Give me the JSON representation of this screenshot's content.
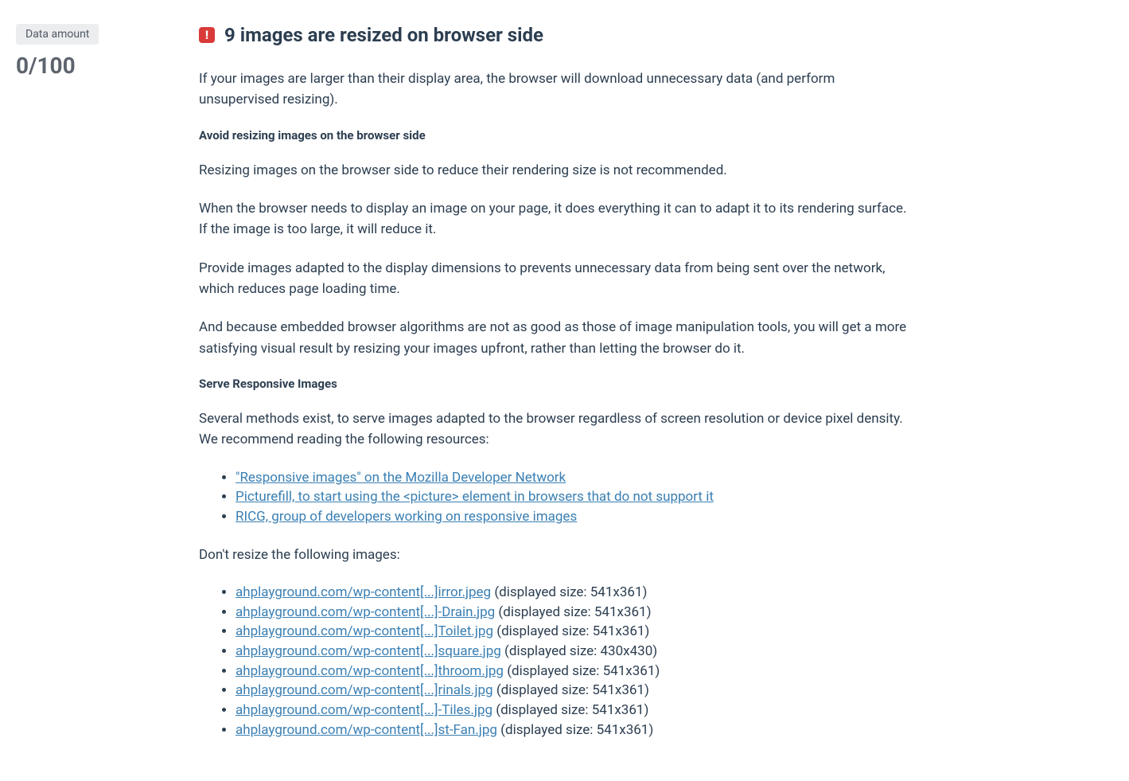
{
  "sidebar": {
    "badge_label": "Data amount",
    "score": "0/100"
  },
  "title": "9 images are resized on browser side",
  "intro": "If your images are larger than their display area, the browser will download unnecessary data (and perform unsupervised resizing).",
  "section1": {
    "heading": "Avoid resizing images on the browser side",
    "p1": "Resizing images on the browser side to reduce their rendering size is not recommended.",
    "p2": "When the browser needs to display an image on your page, it does everything it can to adapt it to its rendering surface. If the image is too large, it will reduce it.",
    "p3": "Provide images adapted to the display dimensions to prevents unnecessary data from being sent over the network, which reduces page loading time.",
    "p4": "And because embedded browser algorithms are not as good as those of image manipulation tools, you will get a more satisfying visual result by resizing your images upfront, rather than letting the browser do it."
  },
  "section2": {
    "heading": "Serve Responsive Images",
    "intro": "Several methods exist, to serve images adapted to the browser regardless of screen resolution or device pixel density. We recommend reading the following resources:",
    "resources": [
      "\"Responsive images\" on the Mozilla Developer Network",
      "Picturefill, to start using the <picture> element in browsers that do not support it",
      "RICG, group of developers working on responsive images"
    ]
  },
  "images_section": {
    "intro": "Don't resize the following images:",
    "items": [
      {
        "url": "ahplayground.com/wp-content[...]irror.jpeg",
        "size": " (displayed size: 541x361)"
      },
      {
        "url": "ahplayground.com/wp-content[...]-Drain.jpg",
        "size": " (displayed size: 541x361)"
      },
      {
        "url": "ahplayground.com/wp-content[...]Toilet.jpg",
        "size": " (displayed size: 541x361)"
      },
      {
        "url": "ahplayground.com/wp-content[...]square.jpg",
        "size": " (displayed size: 430x430)"
      },
      {
        "url": "ahplayground.com/wp-content[...]throom.jpg",
        "size": " (displayed size: 541x361)"
      },
      {
        "url": "ahplayground.com/wp-content[...]rinals.jpg",
        "size": " (displayed size: 541x361)"
      },
      {
        "url": "ahplayground.com/wp-content[...]-Tiles.jpg",
        "size": " (displayed size: 541x361)"
      },
      {
        "url": "ahplayground.com/wp-content[...]st-Fan.jpg",
        "size": " (displayed size: 541x361)"
      }
    ]
  }
}
